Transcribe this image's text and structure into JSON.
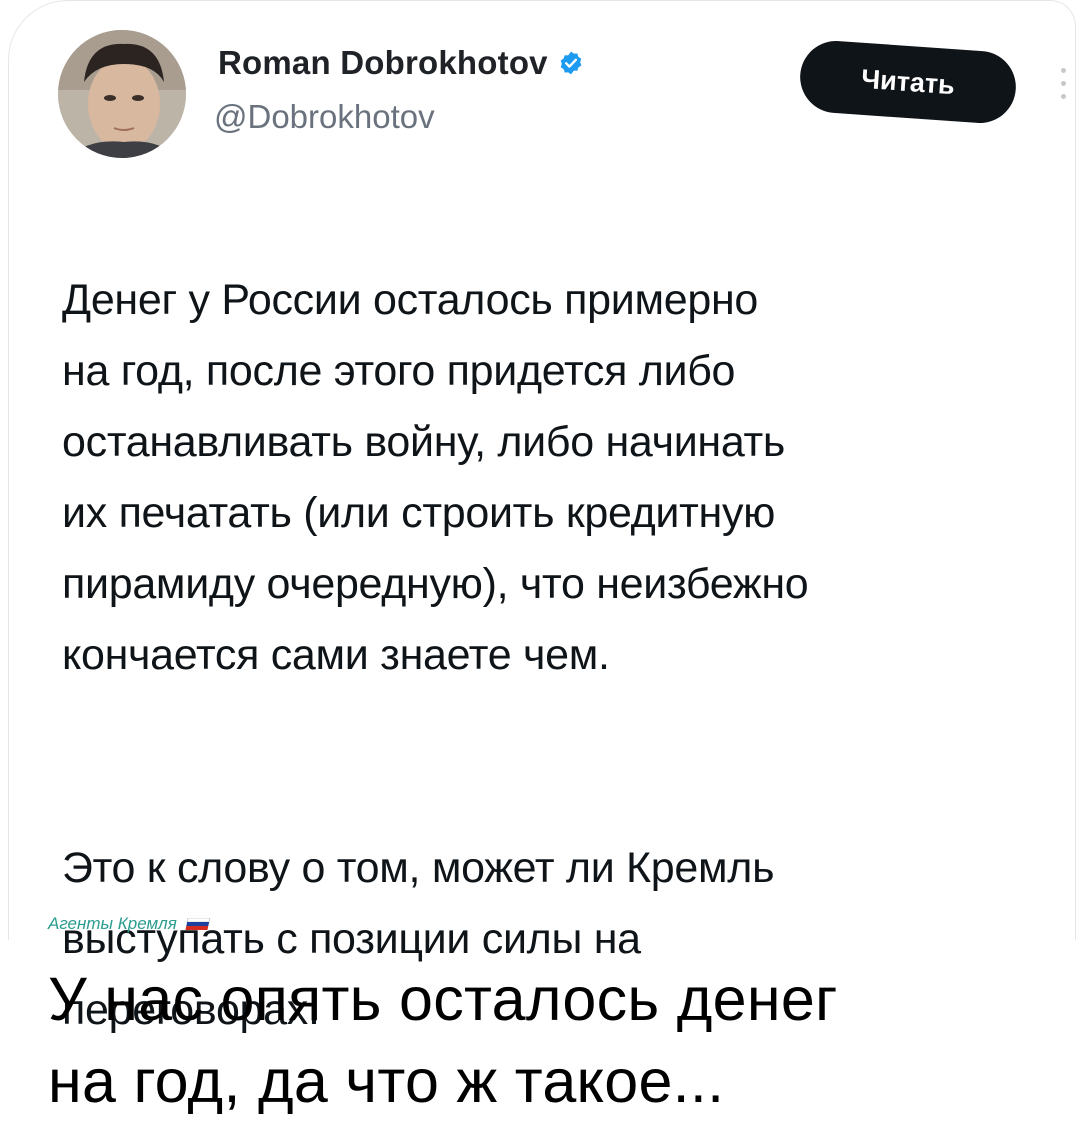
{
  "tweet": {
    "author_name": "Roman Dobrokhotov",
    "handle": "@Dobrokhotov",
    "follow_label": "Читать",
    "text_paragraph_1": "Денег у России осталось примерно\nна год, после этого придется либо\nостанавливать войну, либо начинать\nих печатать (или строить кредитную\nпирамиду очередную), что неизбежно\nкончается сами знаете чем.",
    "text_paragraph_2": "Это к слову о том, может ли Кремль\nвыступать с позиции силы на\nпереговорах."
  },
  "watermark": {
    "text": "Агенты Кремля"
  },
  "caption": {
    "line_1": "У нас опять осталось денег",
    "line_2": "на год, да что ж такое..."
  },
  "colors": {
    "verified": "#1d9bf0",
    "button_bg": "#0f1419",
    "handle": "#6a737d",
    "watermark": "#2a9d8f"
  },
  "icons": {
    "verified": "verified-badge-icon",
    "more": "more-options-icon",
    "flag": "russian-flag-icon"
  }
}
